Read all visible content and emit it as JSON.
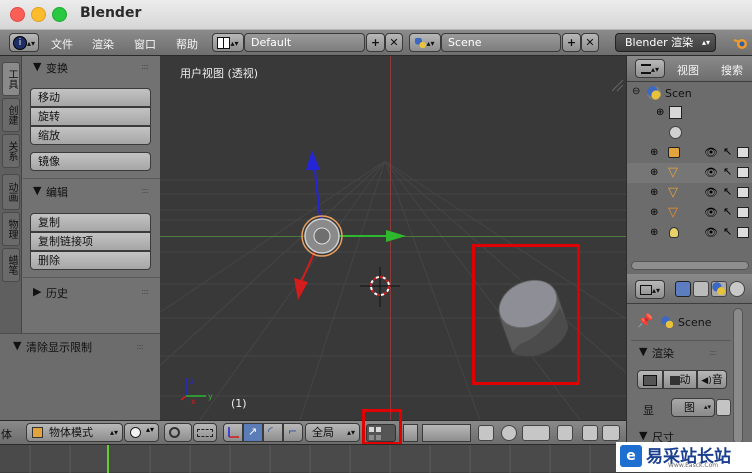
{
  "window": {
    "title": "Blender"
  },
  "header": {
    "menus": [
      "文件",
      "渲染",
      "窗口",
      "帮助"
    ],
    "screen_layout": "Default",
    "scene": "Scene",
    "render_engine": "Blender 渲染"
  },
  "toolshelf": {
    "tabs": [
      "工具",
      "创建",
      "关系",
      "动画",
      "物理",
      "蜡笔"
    ],
    "transform": {
      "title": "变换",
      "buttons": [
        "移动",
        "旋转",
        "缩放"
      ],
      "mirror": "镜像"
    },
    "edit": {
      "title": "编辑",
      "buttons": [
        "复制",
        "复制链接项",
        "删除"
      ]
    },
    "history": {
      "title": "历史"
    },
    "operator": {
      "title": "清除显示限制"
    }
  },
  "viewport": {
    "label": "用户视图 (透视)",
    "frame_label": "(1)"
  },
  "outliner": {
    "view_menu": "视图",
    "search_menu": "搜索",
    "root_label": "Scen"
  },
  "properties": {
    "scene_label": "Scene",
    "render_panel": "渲染",
    "render_buttons": [
      "动",
      "音"
    ],
    "display_label": "显",
    "display_value": "图",
    "dimensions_panel": "尺寸"
  },
  "bottom": {
    "corner_label": "体",
    "mode": "物体模式",
    "transform_orientation": "全局"
  },
  "watermark": {
    "text": "易采站长站",
    "subtext": "Www.Easck.Com"
  },
  "colors": {
    "selection_box": "#e00000",
    "axis_x": "#d31c1c",
    "axis_y": "#2db82d",
    "axis_z": "#2525d8",
    "active_frame": "#66cc33"
  }
}
